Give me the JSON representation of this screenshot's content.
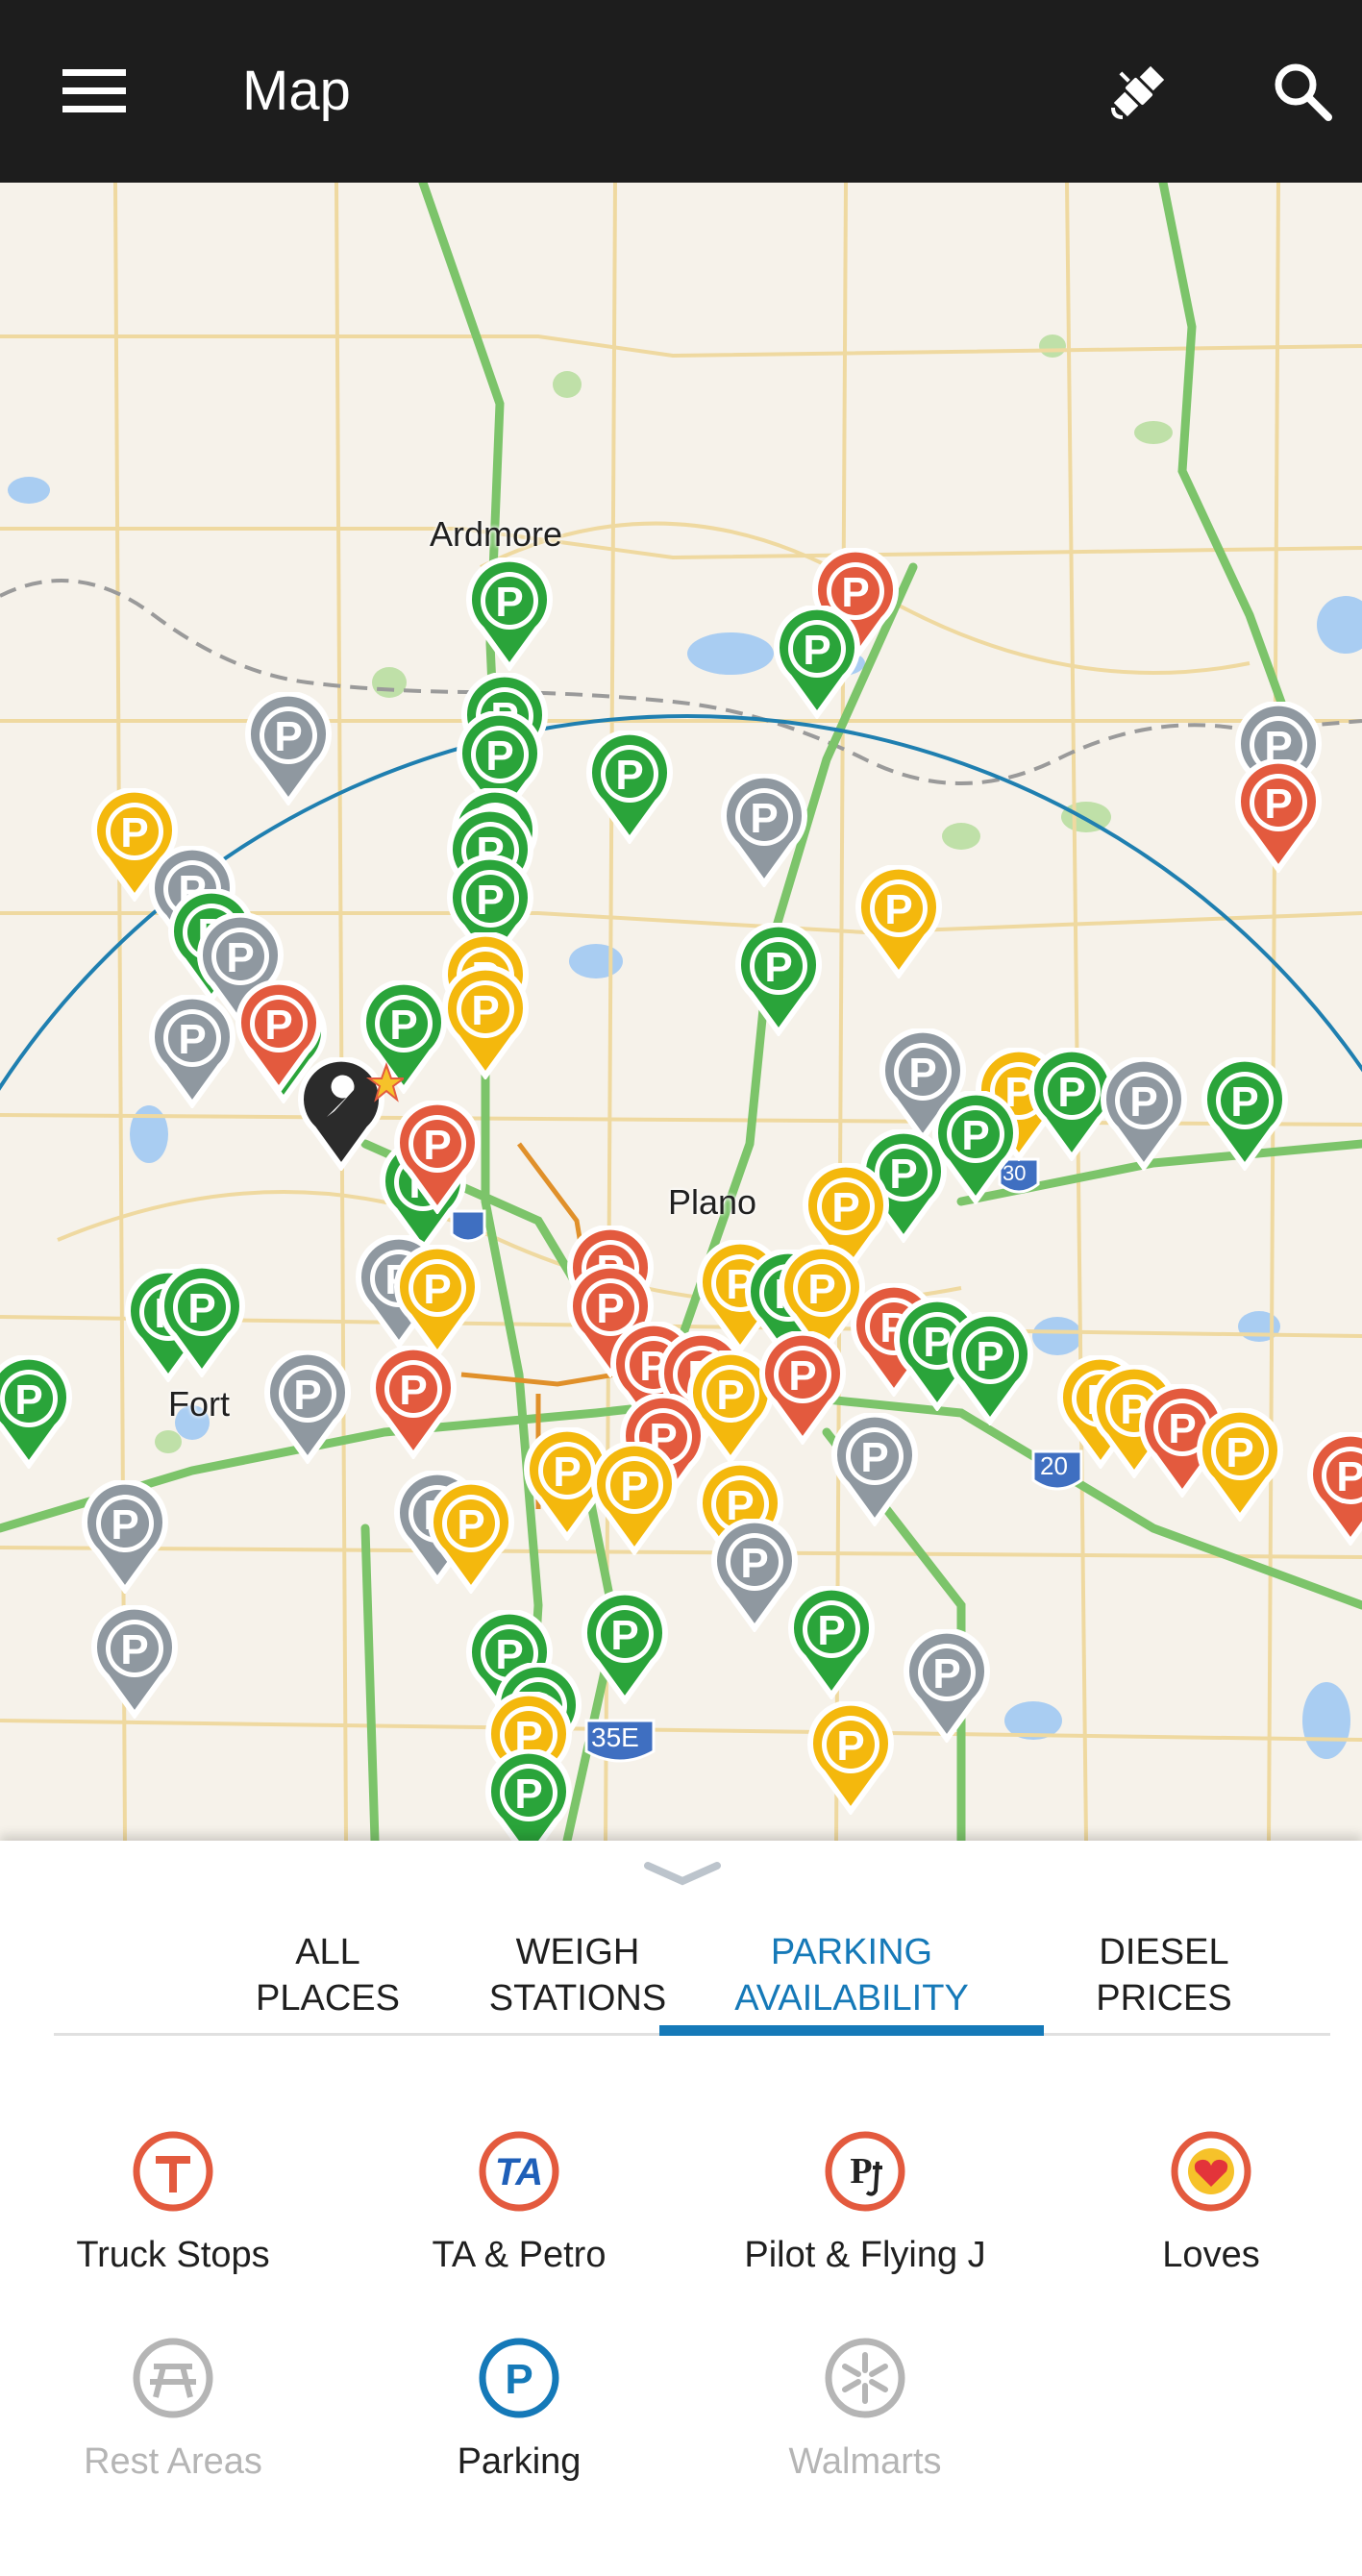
{
  "appbar": {
    "title": "Map",
    "menu_icon": "hamburger-menu-icon",
    "satellite_icon": "satellite-icon",
    "search_icon": "search-icon"
  },
  "map": {
    "labels": {
      "ardmore": "Ardmore",
      "plano": "Plano",
      "fort": "Fort",
      "shield_35e": "35E",
      "shield_30": "30",
      "shield_20": "20"
    },
    "pin_colors": {
      "green": "#2aa43a",
      "yellow": "#f4b80d",
      "red": "#e35a3e",
      "gray": "#8f98a0",
      "dark": "#2b2b2b"
    },
    "pin_letter": "P",
    "radius_circle_color": "#1f7fb0"
  },
  "tabs": [
    {
      "label": "ALL\nPLACES",
      "active": false
    },
    {
      "label": "WEIGH\nSTATIONS",
      "active": false
    },
    {
      "label": "PARKING\nAVAILABILITY",
      "active": true
    },
    {
      "label": "DIESEL\nPRICES",
      "active": false
    }
  ],
  "categories": [
    {
      "label": "Truck Stops",
      "icon": "truck-stop-t-icon",
      "enabled": true
    },
    {
      "label": "TA & Petro",
      "icon": "ta-petro-icon",
      "enabled": true
    },
    {
      "label": "Pilot & Flying J",
      "icon": "pilot-flying-j-icon",
      "enabled": true
    },
    {
      "label": "Loves",
      "icon": "loves-heart-icon",
      "enabled": true
    },
    {
      "label": "Rest Areas",
      "icon": "picnic-table-icon",
      "enabled": false
    },
    {
      "label": "Parking",
      "icon": "parking-p-icon",
      "enabled": true
    },
    {
      "label": "Walmarts",
      "icon": "walmart-spark-icon",
      "enabled": false
    }
  ],
  "colors": {
    "accent": "#1579b8",
    "appbar": "#1d1d1d",
    "category_red": "#e35a3e"
  }
}
